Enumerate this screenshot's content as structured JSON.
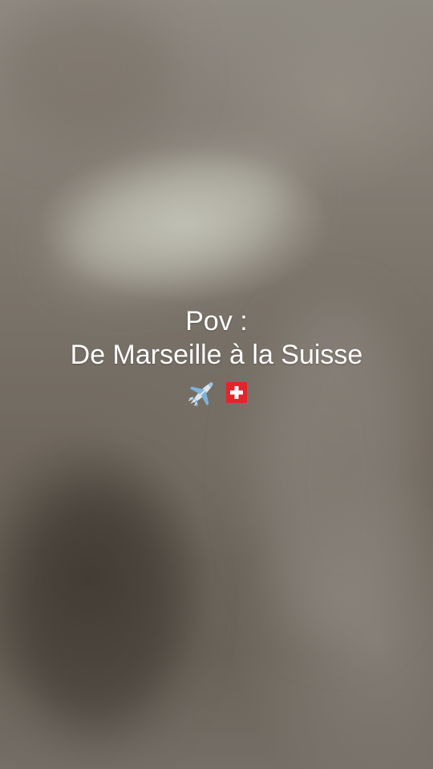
{
  "caption": {
    "line1": "Pov :",
    "line2": "De Marseille à la Suisse"
  },
  "emojis": [
    "airplane-icon",
    "swiss-flag-icon"
  ],
  "colors": {
    "text": "#ffffff",
    "flag_red": "#e4242a",
    "flag_white": "#ffffff",
    "plane_blue": "#7fb2d9"
  }
}
